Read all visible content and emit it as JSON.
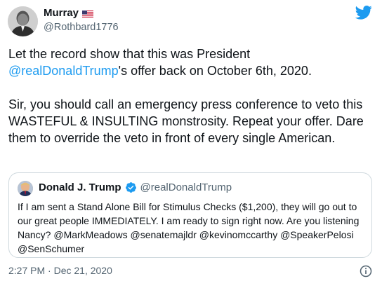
{
  "author": {
    "display_name": "Murray",
    "flag_icon": "us-flag-icon",
    "handle": "@Rothbard1776"
  },
  "tweet": {
    "line1_pre": "Let the record show that this was President",
    "mention": "@realDonaldTrump",
    "line1_post": "'s offer back on October 6th, 2020.",
    "paragraph2": "Sir, you should call an emergency press conference to veto this WASTEFUL & INSULTING monstrosity. Repeat your offer. Dare them to override the veto in front of every single American."
  },
  "quoted_tweet": {
    "display_name": "Donald J. Trump",
    "verified_icon": "verified-badge-icon",
    "handle": "@realDonaldTrump",
    "text": "If I am sent a Stand Alone Bill for Stimulus Checks ($1,200), they will go out to our great people IMMEDIATELY. I am ready to sign right now. Are you listening Nancy? @MarkMeadows @senatemajldr @kevinomccarthy @SpeakerPelosi @SenSchumer"
  },
  "footer": {
    "timestamp": "2:27 PM · Dec 21, 2020"
  },
  "colors": {
    "accent": "#1d9bf0",
    "text_primary": "#0f1419",
    "text_secondary": "#536471",
    "border": "#cfd9de"
  }
}
